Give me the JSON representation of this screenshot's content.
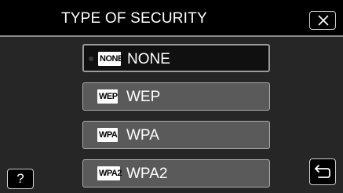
{
  "header": {
    "title": "TYPE OF SECURITY",
    "close_icon": "close-icon"
  },
  "options": [
    {
      "icon_text": "NONE",
      "label": "NONE",
      "selected": true
    },
    {
      "icon_text": "WEP",
      "label": "WEP",
      "selected": false
    },
    {
      "icon_text": "WPA",
      "label": "WPA",
      "selected": false
    },
    {
      "icon_text": "WPA2",
      "label": "WPA2",
      "selected": false
    }
  ],
  "footer": {
    "help_label": "?",
    "back_icon": "back-icon"
  },
  "colors": {
    "background": "#000000",
    "panel": "#262626",
    "option_bg": "#5a5a5a",
    "option_selected_bg": "#101010",
    "text": "#ffffff"
  }
}
